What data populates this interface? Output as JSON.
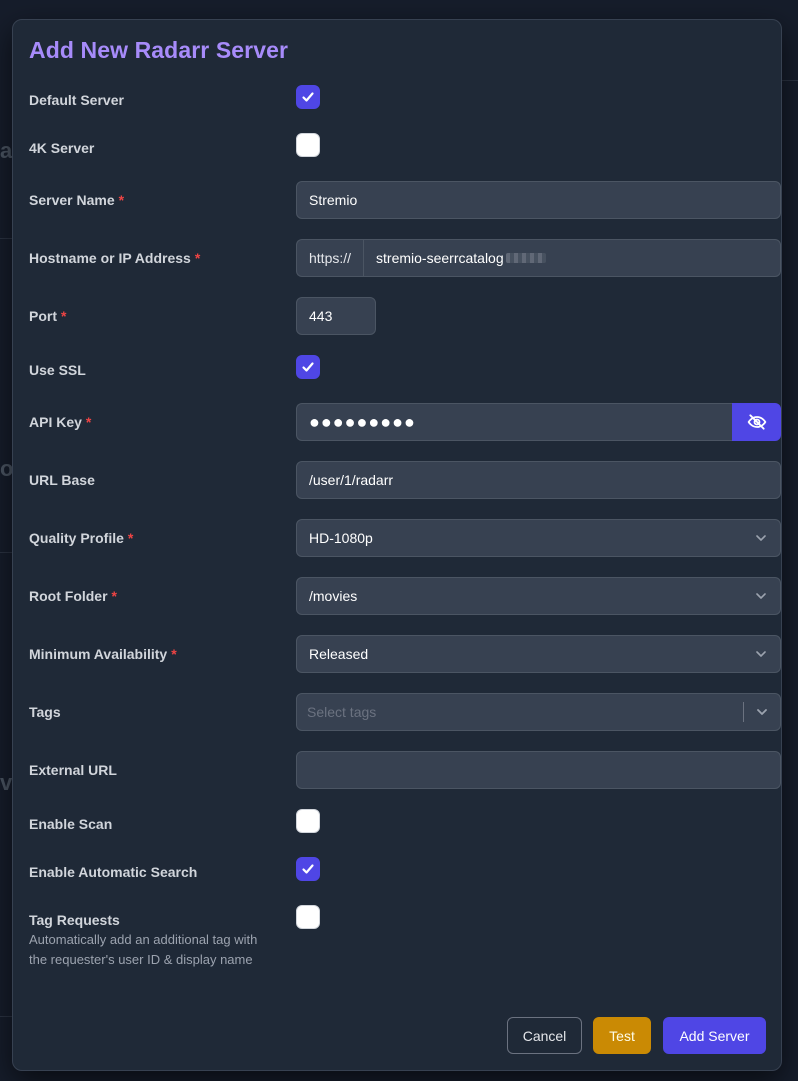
{
  "modal": {
    "title": "Add New Radarr Server"
  },
  "required_mark": "*",
  "fields": {
    "default_server": {
      "label": "Default Server",
      "checked": true
    },
    "k4_server": {
      "label": "4K Server",
      "checked": false
    },
    "server_name": {
      "label": "Server Name",
      "value": "Stremio"
    },
    "hostname": {
      "label": "Hostname or IP Address",
      "prefix": "https://",
      "value": "stremio-seerrcatalog"
    },
    "port": {
      "label": "Port",
      "value": "443"
    },
    "use_ssl": {
      "label": "Use SSL",
      "checked": true
    },
    "api_key": {
      "label": "API Key",
      "value": "●●●●●●●●●",
      "toggle_icon": "eye-off-icon"
    },
    "url_base": {
      "label": "URL Base",
      "value": "/user/1/radarr"
    },
    "quality_profile": {
      "label": "Quality Profile",
      "value": "HD-1080p"
    },
    "root_folder": {
      "label": "Root Folder",
      "value": "/movies"
    },
    "minimum_availability": {
      "label": "Minimum Availability",
      "value": "Released"
    },
    "tags": {
      "label": "Tags",
      "placeholder": "Select tags"
    },
    "external_url": {
      "label": "External URL",
      "value": ""
    },
    "enable_scan": {
      "label": "Enable Scan",
      "checked": false
    },
    "enable_automatic_search": {
      "label": "Enable Automatic Search",
      "checked": true
    },
    "tag_requests": {
      "label": "Tag Requests",
      "help": "Automatically add an additional tag with the requester's user ID & display name",
      "checked": false
    }
  },
  "buttons": {
    "cancel": "Cancel",
    "test": "Test",
    "add": "Add Server"
  },
  "colors": {
    "accent": "#4f46e5",
    "title": "#a78bfa",
    "test": "#ca8a04",
    "required": "#ef4444"
  }
}
